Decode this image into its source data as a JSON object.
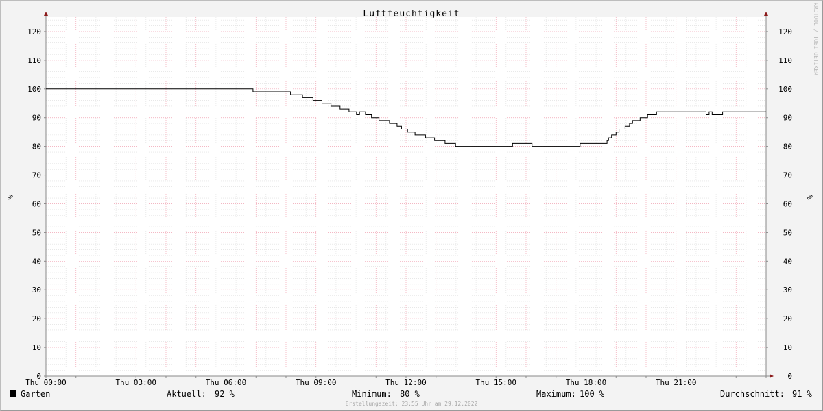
{
  "watermark": "RRDTOOL / TOBI OETIKER",
  "chart_data": {
    "type": "line",
    "title": "Luftfeuchtigkeit",
    "ylabel": "%",
    "ylabel_right": "%",
    "ylim": [
      0,
      125
    ],
    "yticks": [
      0,
      10,
      20,
      30,
      40,
      50,
      60,
      70,
      80,
      90,
      100,
      110,
      120
    ],
    "xlim_hours": [
      0,
      24
    ],
    "xticks": [
      {
        "h": 0,
        "label": "Thu 00:00"
      },
      {
        "h": 3,
        "label": "Thu 03:00"
      },
      {
        "h": 6,
        "label": "Thu 06:00"
      },
      {
        "h": 9,
        "label": "Thu 09:00"
      },
      {
        "h": 12,
        "label": "Thu 12:00"
      },
      {
        "h": 15,
        "label": "Thu 15:00"
      },
      {
        "h": 18,
        "label": "Thu 18:00"
      },
      {
        "h": 21,
        "label": "Thu 21:00"
      }
    ],
    "grid": true,
    "series": [
      {
        "name": "Garten",
        "color": "#000000",
        "step_points": [
          [
            0.0,
            100
          ],
          [
            6.9,
            99
          ],
          [
            8.15,
            98
          ],
          [
            8.55,
            97
          ],
          [
            8.9,
            96
          ],
          [
            9.2,
            95
          ],
          [
            9.5,
            94
          ],
          [
            9.8,
            93
          ],
          [
            10.1,
            92
          ],
          [
            10.35,
            91
          ],
          [
            10.45,
            92
          ],
          [
            10.65,
            91
          ],
          [
            10.85,
            90
          ],
          [
            11.1,
            89
          ],
          [
            11.45,
            88
          ],
          [
            11.7,
            87
          ],
          [
            11.85,
            86
          ],
          [
            12.05,
            85
          ],
          [
            12.3,
            84
          ],
          [
            12.65,
            83
          ],
          [
            12.95,
            82
          ],
          [
            13.3,
            81
          ],
          [
            13.65,
            80
          ],
          [
            15.55,
            81
          ],
          [
            16.2,
            80
          ],
          [
            17.8,
            81
          ],
          [
            18.7,
            82
          ],
          [
            18.75,
            83
          ],
          [
            18.85,
            84
          ],
          [
            19.0,
            85
          ],
          [
            19.1,
            86
          ],
          [
            19.3,
            87
          ],
          [
            19.45,
            88
          ],
          [
            19.55,
            89
          ],
          [
            19.8,
            90
          ],
          [
            20.05,
            91
          ],
          [
            20.35,
            92
          ],
          [
            22.0,
            91
          ],
          [
            22.1,
            92
          ],
          [
            22.2,
            91
          ],
          [
            22.55,
            92
          ],
          [
            24.0,
            92
          ]
        ]
      }
    ]
  },
  "legend": {
    "series_name": "Garten",
    "current_label": "Aktuell:",
    "current_value": "92 %",
    "min_label": "Minimum:",
    "min_value": "80 %",
    "max_label": "Maximum:",
    "max_value": "100 %",
    "avg_label": "Durchschnitt:",
    "avg_value": "91 %"
  },
  "footer": "Erstellungszeit: 23:55 Uhr am 29.12.2022"
}
